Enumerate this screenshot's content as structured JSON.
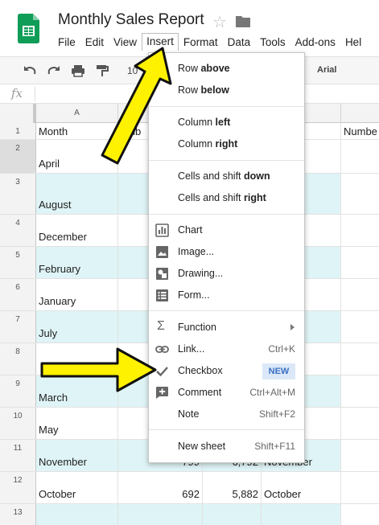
{
  "header": {
    "title": "Monthly Sales Report"
  },
  "menu": {
    "items": [
      "File",
      "Edit",
      "View",
      "Insert",
      "Format",
      "Data",
      "Tools",
      "Add-ons",
      "Hel"
    ]
  },
  "toolbar": {
    "zoom_partial": "10",
    "font": "Arial"
  },
  "formula_bar": {
    "fx_label": "fx"
  },
  "grid": {
    "col_a_label": "A",
    "header_b_partial": "umb",
    "header_f_partial": "Numbe",
    "rows": [
      {
        "num": "1",
        "a": "Month"
      },
      {
        "num": "2",
        "a": "April"
      },
      {
        "num": "3",
        "a": "August"
      },
      {
        "num": "4",
        "a": "December",
        "d": "er"
      },
      {
        "num": "5",
        "a": "February"
      },
      {
        "num": "6",
        "a": "January"
      },
      {
        "num": "7",
        "a": "July"
      },
      {
        "num": "8",
        "a": ""
      },
      {
        "num": "9",
        "a": "March"
      },
      {
        "num": "10",
        "a": "May"
      },
      {
        "num": "11",
        "a": "November",
        "b": "799",
        "c": "6,792",
        "d": "November"
      },
      {
        "num": "12",
        "a": "October",
        "b": "692",
        "c": "5,882",
        "d": "October"
      },
      {
        "num": "13",
        "a": ""
      }
    ]
  },
  "insert_menu": {
    "row_prefix": "Row ",
    "row_above": "above",
    "row_below": "below",
    "column_prefix": "Column ",
    "column_left": "left",
    "column_right": "right",
    "cells_prefix": "Cells and shift ",
    "cells_down": "down",
    "cells_right": "right",
    "chart": "Chart",
    "image": "Image...",
    "drawing": "Drawing...",
    "form": "Form...",
    "function": "Function",
    "link": "Link...",
    "link_shortcut": "Ctrl+K",
    "checkbox": "Checkbox",
    "new_badge": "NEW",
    "comment": "Comment",
    "comment_shortcut": "Ctrl+Alt+M",
    "note": "Note",
    "note_shortcut": "Shift+F2",
    "new_sheet": "New sheet",
    "new_sheet_shortcut": "Shift+F11"
  },
  "colors": {
    "sheets_green": "#0f9d58",
    "band_cyan": "#dff4f6",
    "arrow_yellow": "#fff200",
    "badge_blue": "#3b6fc2"
  }
}
